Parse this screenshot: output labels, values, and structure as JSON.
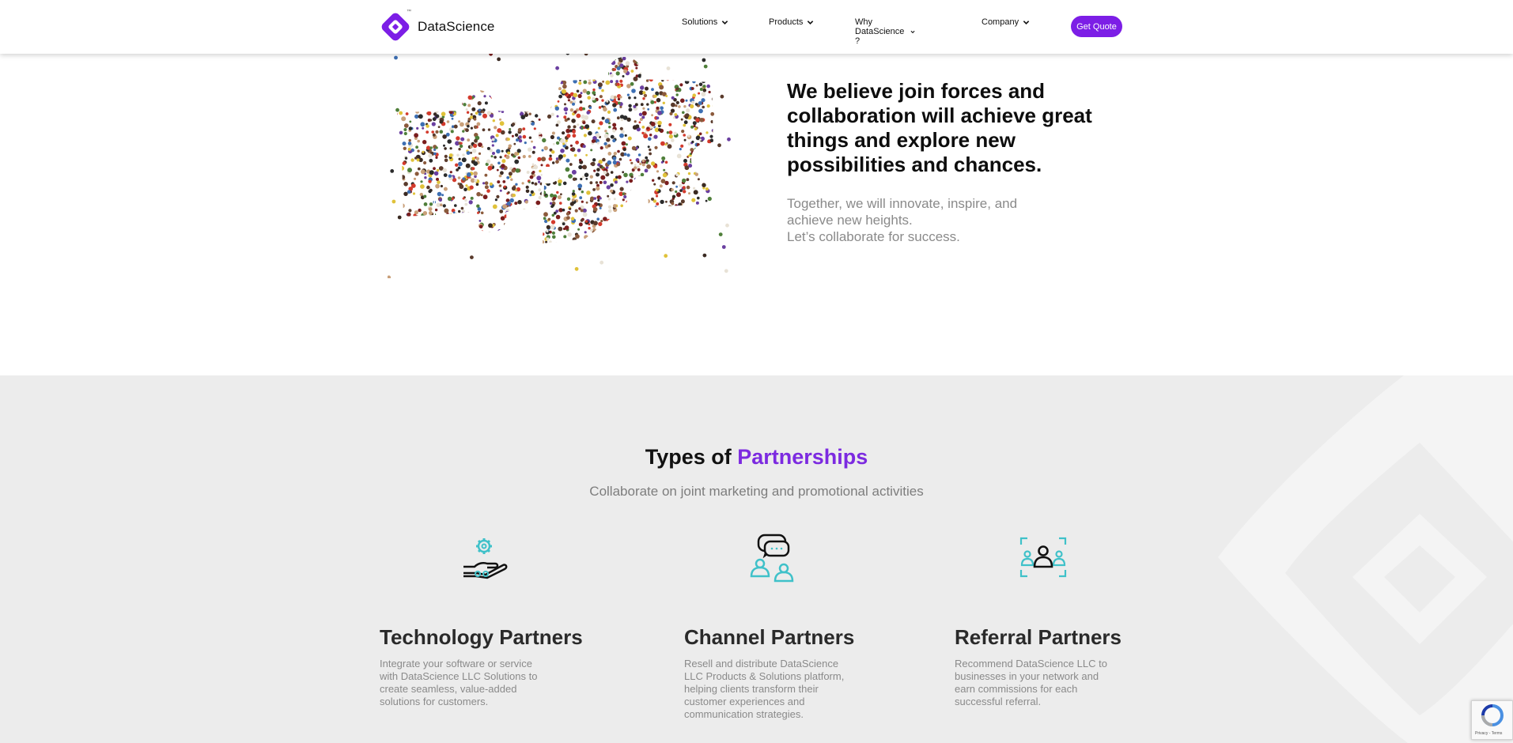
{
  "brand": {
    "name": "DataScience",
    "tm": "™",
    "accent_color": "#7c1ee6"
  },
  "nav": {
    "items": [
      {
        "label": "Solutions",
        "icon": "chevron-down-icon"
      },
      {
        "label": "Products",
        "icon": "chevron-down-icon"
      },
      {
        "label": "Why DataScience ?",
        "icon": "chevron-down-icon"
      },
      {
        "label": "Company",
        "icon": "chevron-down-icon"
      }
    ],
    "cta_label": "Get Quote"
  },
  "hero": {
    "image_icon": "crowd-puzzle-image",
    "heading": "We believe join forces and collaboration will achieve great things and explore new possibilities and chances.",
    "sub_lines": [
      "Together, we will innovate, inspire, and",
      "achieve new heights.",
      "Let’s collaborate for success."
    ]
  },
  "partnerships": {
    "title_plain": "Types of ",
    "title_accent": "Partnerships",
    "subtitle": "Collaborate on joint marketing and promotional activities",
    "cards": [
      {
        "icon": "gear-hand-icon",
        "title": "Technology Partners",
        "lines": [
          "Integrate your software or service",
          "with DataScience LLC Solutions to",
          "create seamless, value-added",
          "solutions for customers."
        ]
      },
      {
        "icon": "chat-people-icon",
        "title": "Channel Partners",
        "lines": [
          "Resell and distribute DataScience",
          "LLC Products & Solutions platform,",
          "helping clients transform their",
          "customer experiences and",
          "communication strategies."
        ]
      },
      {
        "icon": "referral-people-icon",
        "title": "Referral Partners",
        "lines": [
          "Recommend DataScience LLC to",
          "businesses in your network and",
          "earn commissions for each",
          "successful referral."
        ]
      }
    ],
    "icon_color": "#3fc1c9"
  },
  "recaptcha": {
    "footer": "Privacy - Terms"
  }
}
